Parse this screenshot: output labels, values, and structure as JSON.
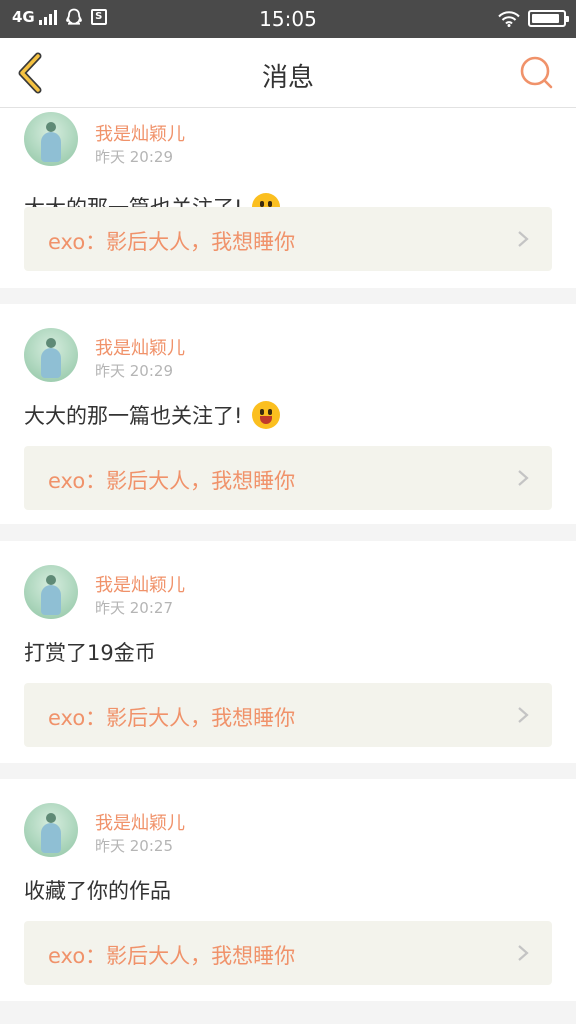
{
  "status_bar": {
    "network": "4G",
    "time": "15:05",
    "battery_level": 0.9
  },
  "nav": {
    "title": "消息"
  },
  "messages": [
    {
      "name": "我是灿颖儿",
      "time": "昨天 20:29",
      "text": "大大的那一篇也关注了!",
      "emoji": true,
      "ref": "exo：影后大人，我想睡你"
    },
    {
      "name": "我是灿颖儿",
      "time": "昨天 20:29",
      "text": "大大的那一篇也关注了!",
      "emoji": true,
      "ref": "exo：影后大人，我想睡你"
    },
    {
      "name": "我是灿颖儿",
      "time": "昨天 20:27",
      "text": "打赏了19金币",
      "emoji": false,
      "ref": "exo：影后大人，我想睡你"
    },
    {
      "name": "我是灿颖儿",
      "time": "昨天 20:25",
      "text": "收藏了你的作品",
      "emoji": false,
      "ref": "exo：影后大人，我想睡你"
    }
  ],
  "colors": {
    "accent": "#f0926a",
    "back_arrow": "#f5c242",
    "status_bar": "#4a4a4a",
    "ref_background": "#f3f3ec"
  }
}
